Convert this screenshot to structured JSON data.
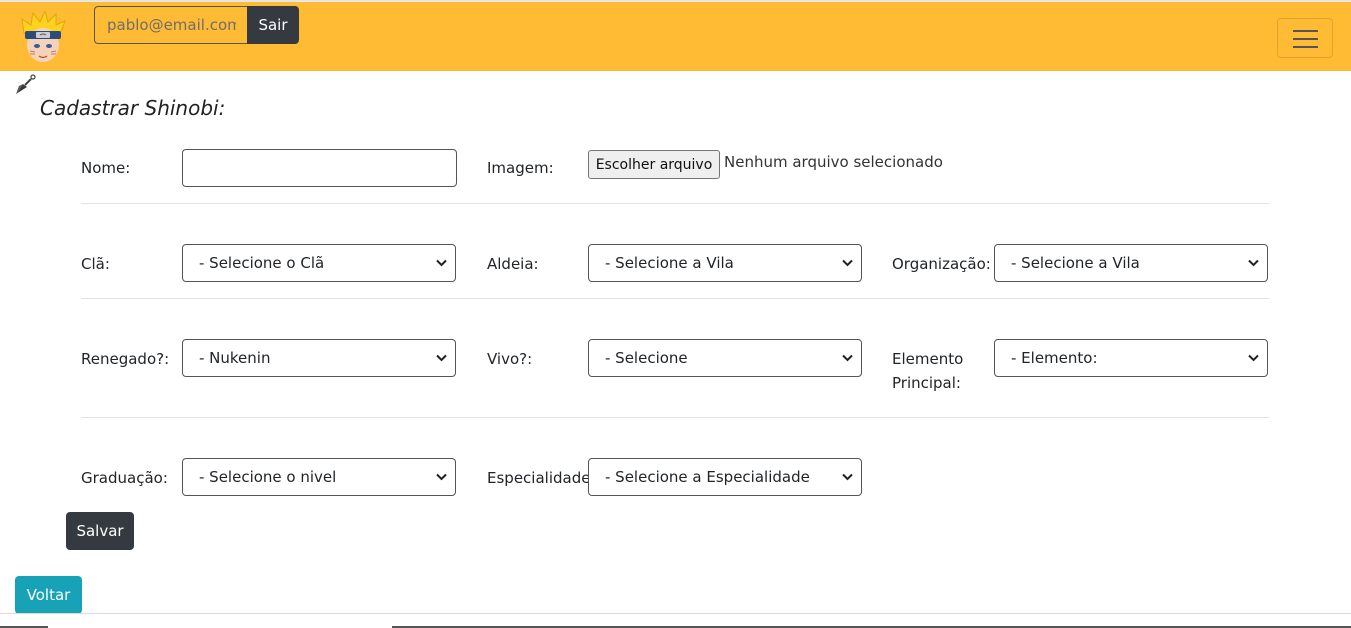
{
  "navbar": {
    "email_placeholder": "pablo@email.com",
    "logout_label": "Sair",
    "avatar_icon": "ninja-avatar-icon",
    "menu_icon": "hamburger-menu-icon",
    "background_color": "#ffbb33"
  },
  "page": {
    "title": "Cadastrar Shinobi:",
    "title_icon": "kunai-icon"
  },
  "form": {
    "nome": {
      "label": "Nome:",
      "value": ""
    },
    "imagem": {
      "label": "Imagem:",
      "button_label": "Escolher arquivo",
      "status": "Nenhum arquivo selecionado"
    },
    "cla": {
      "label": "Clã:",
      "selected": "- Selecione o Clã"
    },
    "aldeia": {
      "label": "Aldeia:",
      "selected": "- Selecione a Vila"
    },
    "organizacao": {
      "label": "Organização:",
      "selected": "- Selecione a Vila"
    },
    "renegado": {
      "label": "Renegado?:",
      "selected": "- Nukenin"
    },
    "vivo": {
      "label": "Vivo?:",
      "selected": "- Selecione"
    },
    "elemento": {
      "label_line1": "Elemento",
      "label_line2": "Principal:",
      "selected": "- Elemento:"
    },
    "graduacao": {
      "label": "Graduação:",
      "selected": "- Selecione o nivel"
    },
    "especialidade": {
      "label": "Especialidade:",
      "selected": "- Selecione a Especialidade"
    },
    "save_label": "Salvar"
  },
  "footer": {
    "back_label": "Voltar",
    "back_color": "#17a2b8"
  }
}
